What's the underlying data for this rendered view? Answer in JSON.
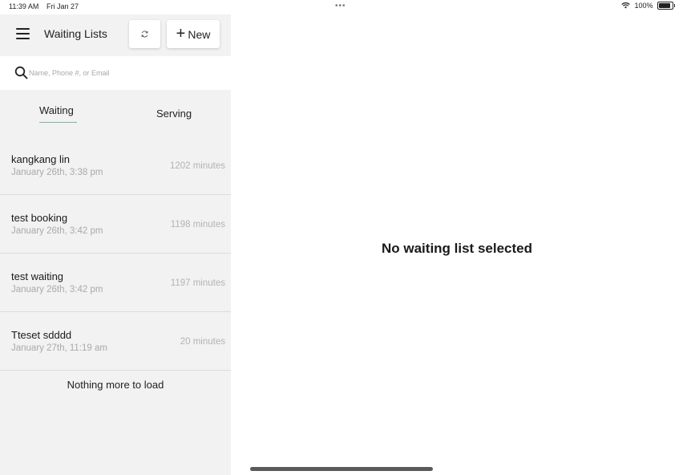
{
  "status_bar": {
    "time": "11:39 AM",
    "date": "Fri Jan 27",
    "battery": "100%"
  },
  "header": {
    "title": "Waiting Lists",
    "new_label": "New"
  },
  "search": {
    "placeholder": "Name, Phone #, or Email",
    "value": ""
  },
  "tabs": [
    {
      "label": "Waiting",
      "active": true
    },
    {
      "label": "Serving",
      "active": false
    }
  ],
  "entries": [
    {
      "name": "kangkang lin",
      "time": "January 26th, 3:38 pm",
      "minutes": "1202 minutes"
    },
    {
      "name": "test booking",
      "time": "January 26th, 3:42 pm",
      "minutes": "1198 minutes"
    },
    {
      "name": "test waiting",
      "time": "January 26th, 3:42 pm",
      "minutes": "1197 minutes"
    },
    {
      "name": "Tteset sdddd",
      "time": "January 27th, 11:19 am",
      "minutes": "20 minutes"
    }
  ],
  "list_footer": "Nothing more to load",
  "detail": {
    "empty_message": "No waiting list selected"
  },
  "icons": {
    "menu": "hamburger-icon",
    "refresh": "refresh-icon",
    "add": "plus-icon",
    "search": "search-icon",
    "wifi": "wifi-icon",
    "battery": "battery-icon"
  },
  "colors": {
    "sidebar_bg": "#f2f2f2",
    "tab_underline": "#8fa9a4",
    "muted_text": "#a9a9a9"
  }
}
